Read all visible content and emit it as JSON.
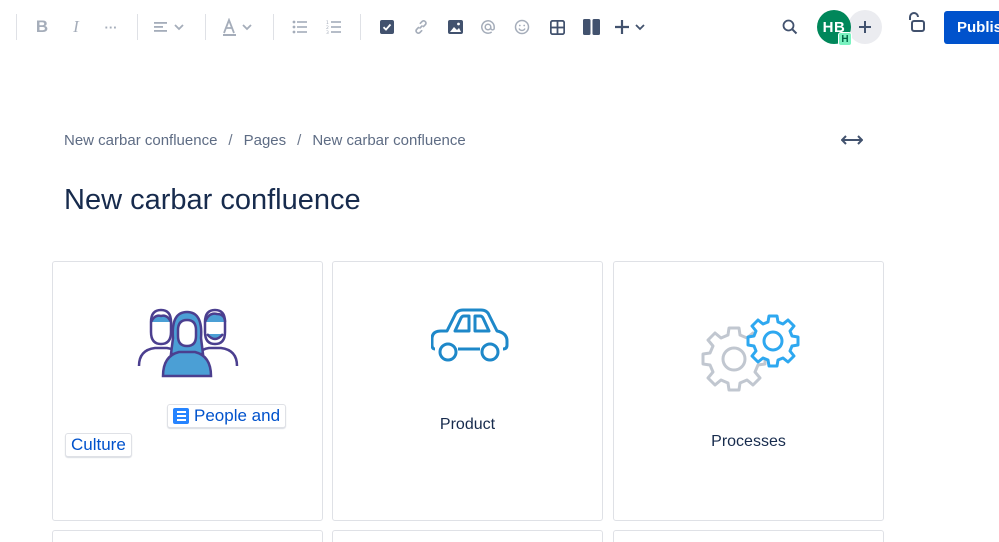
{
  "toolbar": {
    "bold_label": "B",
    "italic_label": "I",
    "more_format_label": "···",
    "publish_label": "Publish",
    "avatar_initials": "HB",
    "avatar_badge": "H"
  },
  "breadcrumb": {
    "items": [
      "New carbar confluence",
      "Pages",
      "New carbar confluence"
    ],
    "separator": "/"
  },
  "page": {
    "title": "New carbar confluence"
  },
  "cards": [
    {
      "icon": "people-icon",
      "link_line1": "People and",
      "link_line2": "Culture"
    },
    {
      "icon": "car-icon",
      "label": "Product"
    },
    {
      "icon": "gears-icon",
      "label": "Processes"
    }
  ],
  "colors": {
    "accent": "#0052cc",
    "avatar": "#00875a",
    "icon_blue": "#1e88c9",
    "icon_purple": "#4b3f8f",
    "gear_gray": "#c1c7d0",
    "gear_blue": "#2ea8f0"
  }
}
